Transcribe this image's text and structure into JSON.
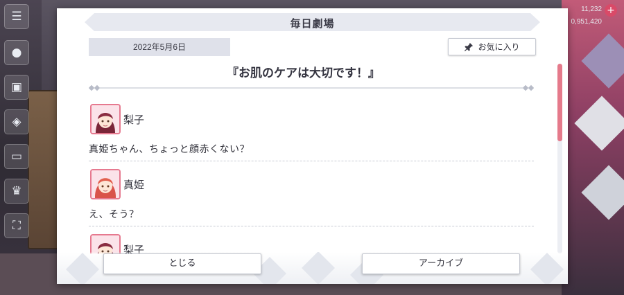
{
  "dialog": {
    "title": "毎日劇場",
    "date": "2022年5月6日",
    "favorite_label": "お気に入り",
    "story_title": "『お肌のケアは大切です！』",
    "messages": [
      {
        "speaker": "梨子",
        "text": "真姫ちゃん、ちょっと顔赤くない？",
        "avatar": "riko-avatar"
      },
      {
        "speaker": "真姫",
        "text": "え、そう？",
        "avatar": "maki-avatar"
      },
      {
        "speaker": "梨子",
        "text": "",
        "avatar": "riko-avatar"
      }
    ],
    "close_label": "とじる",
    "archive_label": "アーカイブ"
  },
  "background": {
    "currency_top": "11,232",
    "currency_bottom": "0,951,420",
    "accent_color": "#e57a8b"
  },
  "left_strip_icons": [
    "menu-icon",
    "chat-icon",
    "shop-icon",
    "gift-icon",
    "monitor-icon",
    "trophy-icon",
    "fullscreen-icon"
  ]
}
